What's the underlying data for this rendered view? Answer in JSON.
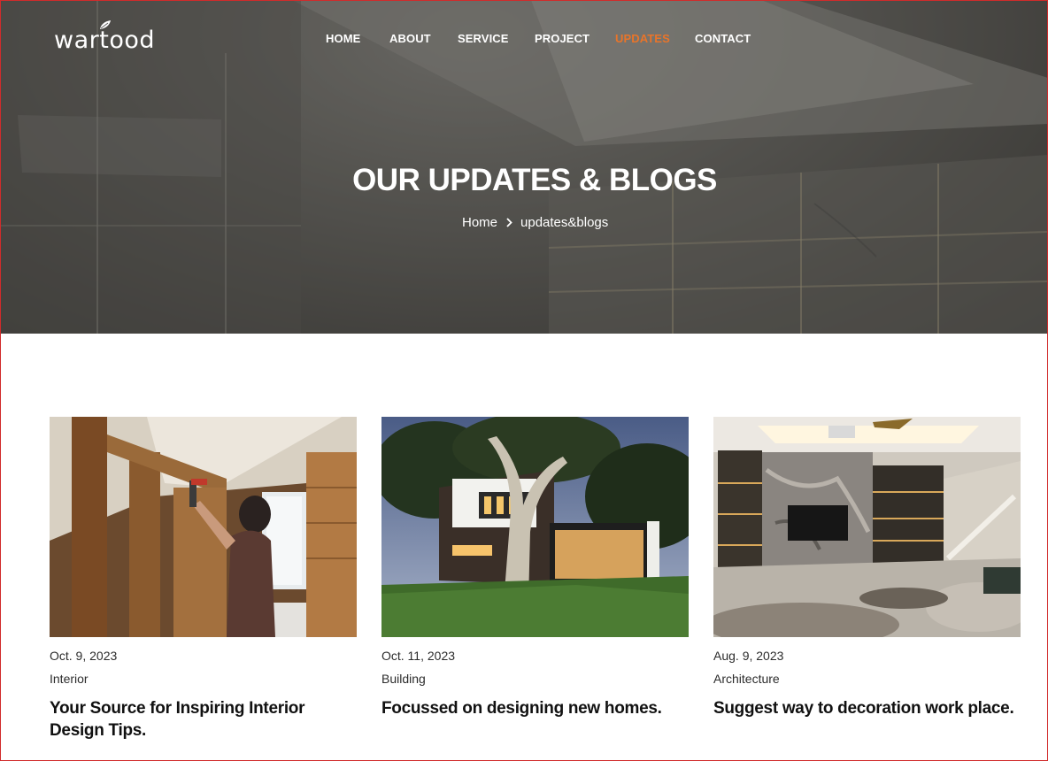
{
  "brand": {
    "logo_text": "wartood"
  },
  "nav": {
    "items": [
      {
        "label": "HOME",
        "active": false
      },
      {
        "label": "ABOUT",
        "active": false
      },
      {
        "label": "SERVICE",
        "active": false
      },
      {
        "label": "PROJECT",
        "active": false
      },
      {
        "label": "UPDATES",
        "active": true
      },
      {
        "label": "CONTACT",
        "active": false
      }
    ]
  },
  "hero": {
    "title": "OUR UPDATES & BLOGS",
    "breadcrumb": {
      "home": "Home",
      "current": "updates&blogs",
      "separator_icon": "chevron-right-icon"
    }
  },
  "posts": [
    {
      "date": "Oct. 9, 2023",
      "category": "Interior",
      "title": "Your Source for Inspiring Interior Design Tips."
    },
    {
      "date": "Oct. 11, 2023",
      "category": "Building",
      "title": "Focussed on designing new homes."
    },
    {
      "date": "Aug. 9, 2023",
      "category": "Architecture",
      "title": "Suggest way to decoration work place."
    }
  ],
  "colors": {
    "accent": "#e8742a",
    "text_dark": "#111111",
    "text_muted": "#2c2c2c",
    "white": "#ffffff"
  }
}
